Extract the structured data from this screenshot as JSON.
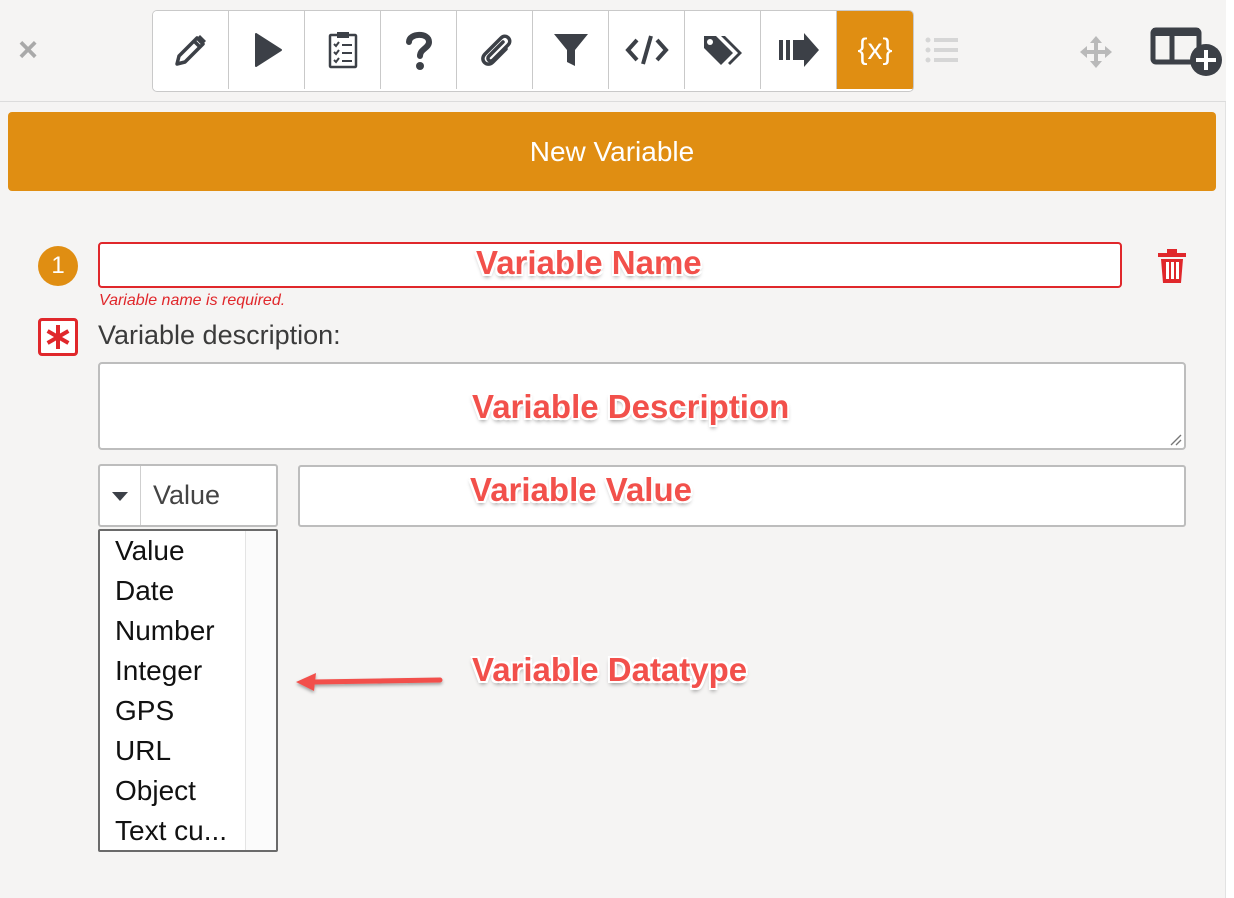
{
  "toolbar": {
    "tools": [
      "pencil-icon",
      "play-icon",
      "clipboard-icon",
      "question-icon",
      "paperclip-icon",
      "filter-icon",
      "code-icon",
      "tags-icon",
      "forward-icon",
      "variable-icon"
    ],
    "active_label": "{x}",
    "accent_color": "#e08e12"
  },
  "header": {
    "title": "New Variable"
  },
  "variable": {
    "step_number": "1",
    "name_value": "",
    "error": "Variable name is required.",
    "description_label": "Variable description:",
    "description_value": "",
    "datatype_selected": "Value",
    "value": ""
  },
  "datatype_options": [
    "Value",
    "Date",
    "Number",
    "Integer",
    "GPS",
    "URL",
    "Object",
    "Text cu..."
  ],
  "annotations": {
    "name": "Variable Name",
    "description": "Variable Description",
    "value": "Variable Value",
    "datatype": "Variable Datatype"
  },
  "colors": {
    "error": "#e0272b",
    "annotation": "#f2504b"
  }
}
